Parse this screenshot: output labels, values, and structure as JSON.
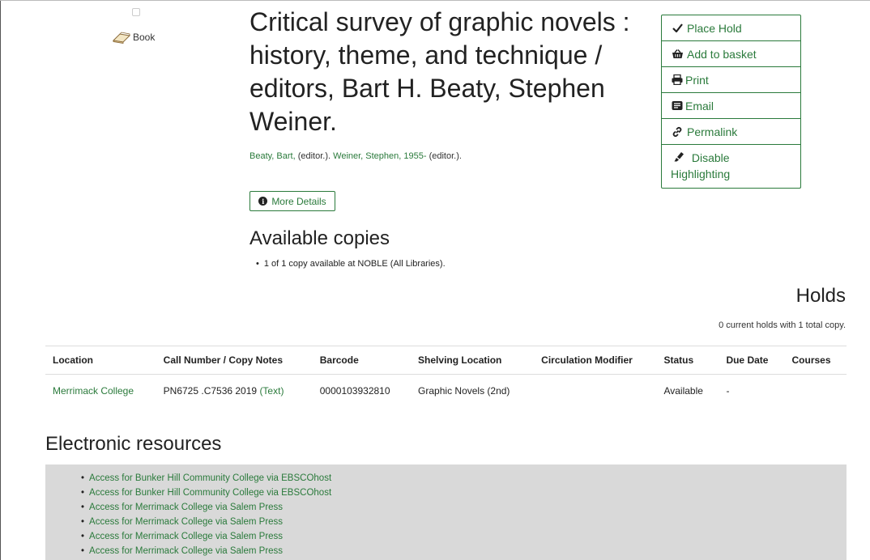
{
  "record": {
    "format_label": "Book",
    "format_icon": "book-icon",
    "title": "Critical survey of graphic novels : history, theme, and technique / editors, Bart H. Beaty, Stephen Weiner.",
    "authors": [
      {
        "name": "Beaty, Bart,",
        "role": "(editor.)."
      },
      {
        "name": "Weiner, Stephen, 1955-",
        "role": "(editor.)."
      }
    ],
    "more_details_label": "More Details"
  },
  "actions": [
    {
      "label": "Place Hold",
      "icon": "check-icon"
    },
    {
      "label": "Add to basket",
      "icon": "basket-icon"
    },
    {
      "label": "Print",
      "icon": "print-icon"
    },
    {
      "label": "Email",
      "icon": "email-icon"
    },
    {
      "label": "Permalink",
      "icon": "link-icon"
    },
    {
      "label_line1": "Disable",
      "label_line2": "Highlighting",
      "icon": "highlighter-icon"
    }
  ],
  "available": {
    "heading": "Available copies",
    "items": [
      "1 of 1 copy available at NOBLE (All Libraries)."
    ]
  },
  "holds": {
    "heading": "Holds",
    "summary": "0 current holds with 1 total copy."
  },
  "copies_table": {
    "headers": [
      "Location",
      "Call Number / Copy Notes",
      "Barcode",
      "Shelving Location",
      "Circulation Modifier",
      "Status",
      "Due Date",
      "Courses"
    ],
    "rows": [
      {
        "location": "Merrimack College",
        "call_number": "PN6725 .C7536 2019",
        "call_note": "(Text)",
        "barcode": "0000103932810",
        "shelving": "Graphic Novels (2nd)",
        "circ_modifier": "",
        "status": "Available",
        "due_date": "-",
        "courses": ""
      }
    ]
  },
  "electronic": {
    "heading": "Electronic resources",
    "links": [
      "Access for Bunker Hill Community College via EBSCOhost",
      "Access for Bunker Hill Community College via EBSCOhost",
      "Access for Merrimack College via Salem Press",
      "Access for Merrimack College via Salem Press",
      "Access for Merrimack College via Salem Press",
      "Access for Merrimack College via Salem Press"
    ]
  },
  "colors": {
    "accent": "#2a7a3b",
    "resource_bg": "#d9d9d9"
  }
}
